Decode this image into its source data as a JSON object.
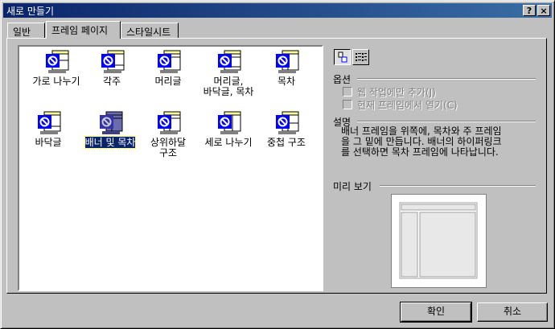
{
  "window": {
    "title": "새로 만들기",
    "help_label": "?",
    "close_label": "×"
  },
  "tabs": [
    {
      "label": "일반",
      "active": false
    },
    {
      "label": "프레임 페이지",
      "active": true
    },
    {
      "label": "스타일시트",
      "active": false
    }
  ],
  "items": [
    {
      "label": "가로 나누기",
      "selected": false
    },
    {
      "label": "각주",
      "selected": false
    },
    {
      "label": "머리글",
      "selected": false
    },
    {
      "label_line1": "머리글,",
      "label_line2": "바닥글, 목차",
      "selected": false
    },
    {
      "label": "목차",
      "selected": false
    },
    {
      "label": "바닥글",
      "selected": false
    },
    {
      "label": "배너 및 목차",
      "selected": true
    },
    {
      "label_line1": "상위하달",
      "label_line2": "구조",
      "selected": false
    },
    {
      "label": "세로 나누기",
      "selected": false
    },
    {
      "label": "중첩 구조",
      "selected": false
    }
  ],
  "options": {
    "heading": "옵션",
    "web_only": "웹 작업에만 추가(J)",
    "open_in_frame": "현재 프레임에서 열기(C)"
  },
  "description": {
    "heading": "설명",
    "text_line1": "배너 프레임을 위쪽에, 목차와 주 프레임",
    "text_line2": "을 그 밑에 만듭니다. 배너의 하이퍼링크",
    "text_line3": "를 선택하면 목차 프레임에 나타납니다."
  },
  "preview": {
    "heading": "미리 보기"
  },
  "buttons": {
    "ok": "확인",
    "cancel": "취소"
  },
  "colors": {
    "title_start": "#0a246a",
    "title_end": "#3a6ea5",
    "face": "#c0c0c0",
    "selection": "#0a246a"
  }
}
